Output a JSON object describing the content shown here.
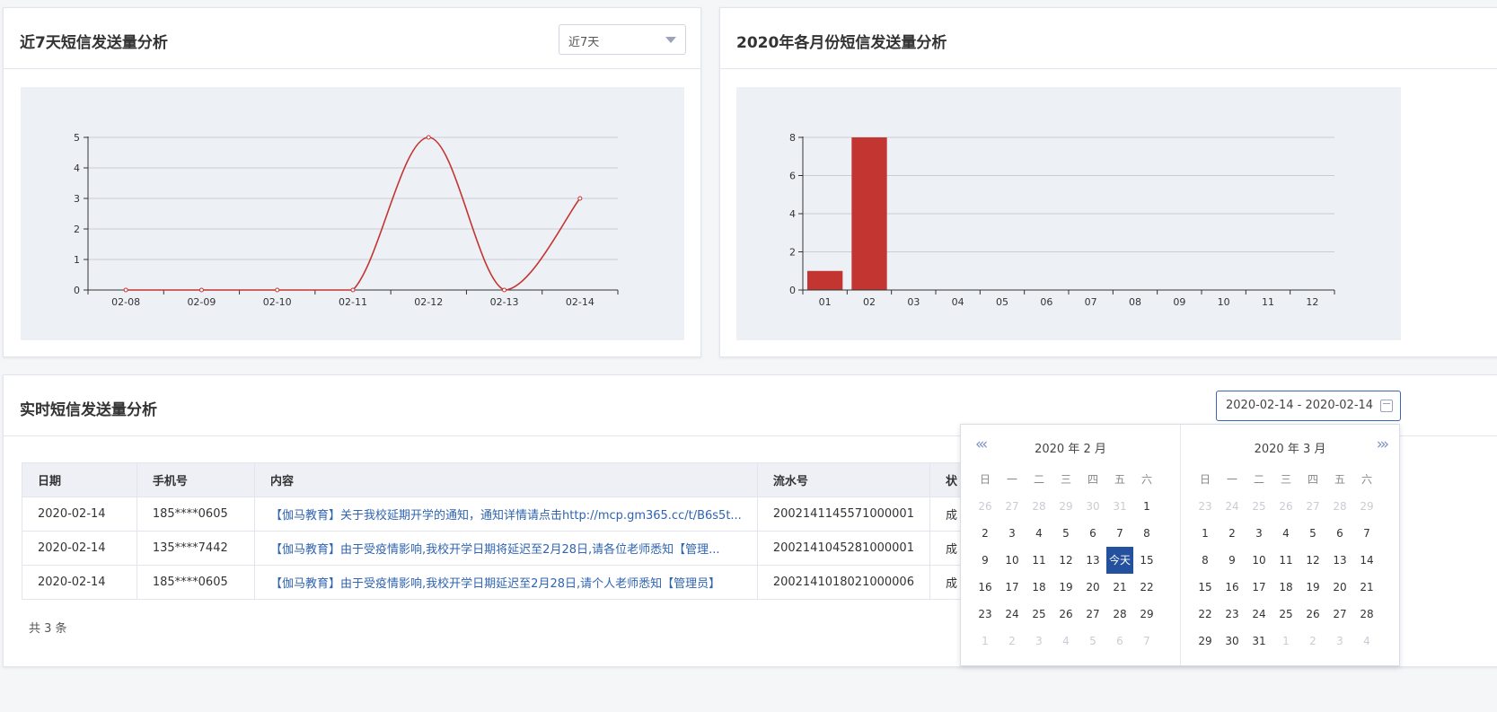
{
  "panel_week": {
    "title": "近7天短信发送量分析",
    "select_value": "近7天",
    "chart_data": {
      "type": "line",
      "categories": [
        "02-08",
        "02-09",
        "02-10",
        "02-11",
        "02-12",
        "02-13",
        "02-14"
      ],
      "values": [
        0,
        0,
        0,
        0,
        5,
        0,
        3
      ],
      "ylim": [
        0,
        5
      ],
      "yticks": [
        "0",
        "1",
        "2",
        "3",
        "4",
        "5"
      ],
      "color": "#c23531",
      "smooth": true,
      "grid": true
    }
  },
  "panel_month": {
    "title": "2020年各月份短信发送量分析",
    "chart_data": {
      "type": "bar",
      "categories": [
        "01",
        "02",
        "03",
        "04",
        "05",
        "06",
        "07",
        "08",
        "09",
        "10",
        "11",
        "12"
      ],
      "values": [
        1,
        8,
        0,
        0,
        0,
        0,
        0,
        0,
        0,
        0,
        0,
        0
      ],
      "ylim": [
        0,
        8
      ],
      "yticks": [
        "0",
        "2",
        "4",
        "6",
        "8"
      ],
      "color": "#c23531",
      "grid": true
    }
  },
  "realtime": {
    "title": "实时短信发送量分析",
    "date_range": "2020-02-14 - 2020-02-14",
    "columns": [
      "日期",
      "手机号",
      "内容",
      "流水号",
      "状"
    ],
    "rows": [
      [
        "2020-02-14",
        "185****0605",
        "【伽马教育】关于我校延期开学的通知，通知详情请点击http://mcp.gm365.cc/t/B6s5t...",
        "2002141145571000001",
        "成"
      ],
      [
        "2020-02-14",
        "135****7442",
        "【伽马教育】由于受疫情影响,我校开学日期将延迟至2月28日,请各位老师悉知【管理...",
        "2002141045281000001",
        "成"
      ],
      [
        "2020-02-14",
        "185****0605",
        "【伽马教育】由于受疫情影响,我校开学日期延迟至2月28日,请个人老师悉知【管理员】",
        "2002141018021000006",
        "成"
      ]
    ],
    "total": "共 3 条"
  },
  "calendar": {
    "weekdays": [
      "日",
      "一",
      "二",
      "三",
      "四",
      "五",
      "六"
    ],
    "left": {
      "title": "2020 年 2 月",
      "nav": "«‹",
      "days": [
        "26",
        "27",
        "28",
        "29",
        "30",
        "31",
        "1",
        "2",
        "3",
        "4",
        "5",
        "6",
        "7",
        "8",
        "9",
        "10",
        "11",
        "12",
        "13",
        "今天",
        "15",
        "16",
        "17",
        "18",
        "19",
        "20",
        "21",
        "22",
        "23",
        "24",
        "25",
        "26",
        "27",
        "28",
        "29",
        "1",
        "2",
        "3",
        "4",
        "5",
        "6",
        "7"
      ],
      "dim_before": 6,
      "dim_after": 7,
      "today_index": 19
    },
    "right": {
      "title": "2020 年 3 月",
      "nav": "›»",
      "days": [
        "23",
        "24",
        "25",
        "26",
        "27",
        "28",
        "29",
        "1",
        "2",
        "3",
        "4",
        "5",
        "6",
        "7",
        "8",
        "9",
        "10",
        "11",
        "12",
        "13",
        "14",
        "15",
        "16",
        "17",
        "18",
        "19",
        "20",
        "21",
        "22",
        "23",
        "24",
        "25",
        "26",
        "27",
        "28",
        "29",
        "30",
        "31",
        "1",
        "2",
        "3",
        "4"
      ],
      "dim_before": 7,
      "dim_after": 4,
      "today_index": -1
    }
  }
}
